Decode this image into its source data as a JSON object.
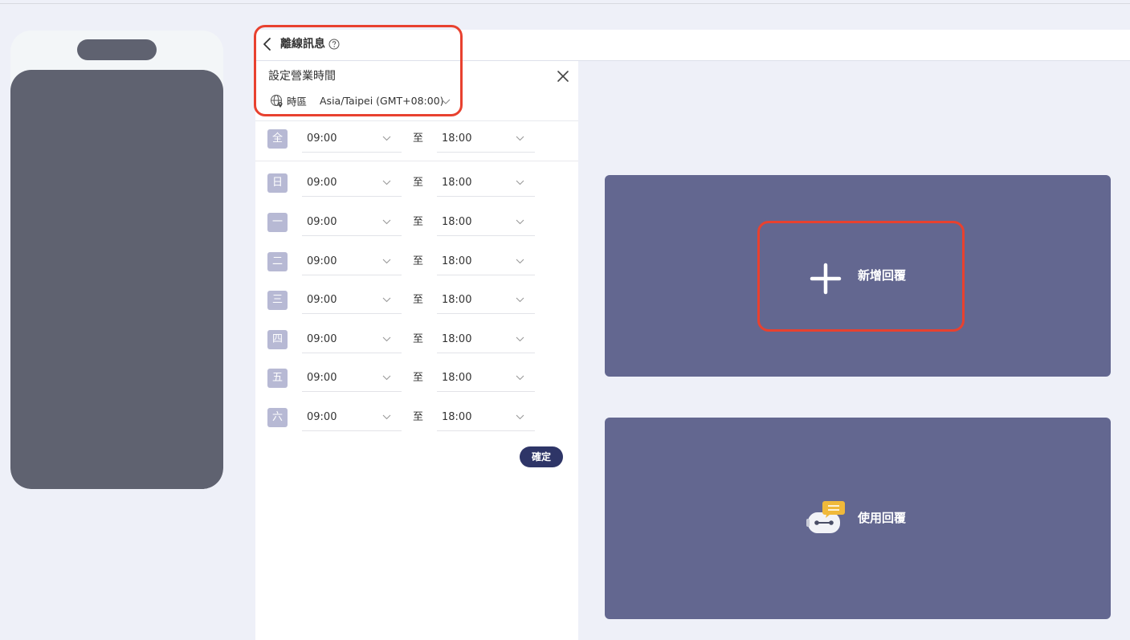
{
  "panel": {
    "title": "離線訊息",
    "section_title": "設定營業時間",
    "timezone_label": "時區",
    "timezone_value": "Asia/Taipei (GMT+08:00)",
    "all_row": {
      "day": "全",
      "start": "09:00",
      "to": "至",
      "end": "18:00"
    },
    "days": [
      {
        "day": "日",
        "start": "09:00",
        "to": "至",
        "end": "18:00"
      },
      {
        "day": "一",
        "start": "09:00",
        "to": "至",
        "end": "18:00"
      },
      {
        "day": "二",
        "start": "09:00",
        "to": "至",
        "end": "18:00"
      },
      {
        "day": "三",
        "start": "09:00",
        "to": "至",
        "end": "18:00"
      },
      {
        "day": "四",
        "start": "09:00",
        "to": "至",
        "end": "18:00"
      },
      {
        "day": "五",
        "start": "09:00",
        "to": "至",
        "end": "18:00"
      },
      {
        "day": "六",
        "start": "09:00",
        "to": "至",
        "end": "18:00"
      }
    ],
    "confirm_label": "確定"
  },
  "cards": {
    "add_reply_label": "新增回覆",
    "use_reply_label": "使用回覆"
  },
  "colors": {
    "background": "#eef0f8",
    "card": "#636790",
    "primary_button": "#2e3567",
    "day_badge": "#b7b9d4",
    "annotation": "#e8412f",
    "phone": "#5f6270"
  },
  "icons": {
    "back": "chevron-left-icon",
    "help": "question-circle-icon",
    "close": "close-icon",
    "timezone": "globe-pin-icon",
    "dropdown": "chevron-down-icon",
    "add": "plus-icon",
    "use_reply": "chatbot-icon"
  }
}
